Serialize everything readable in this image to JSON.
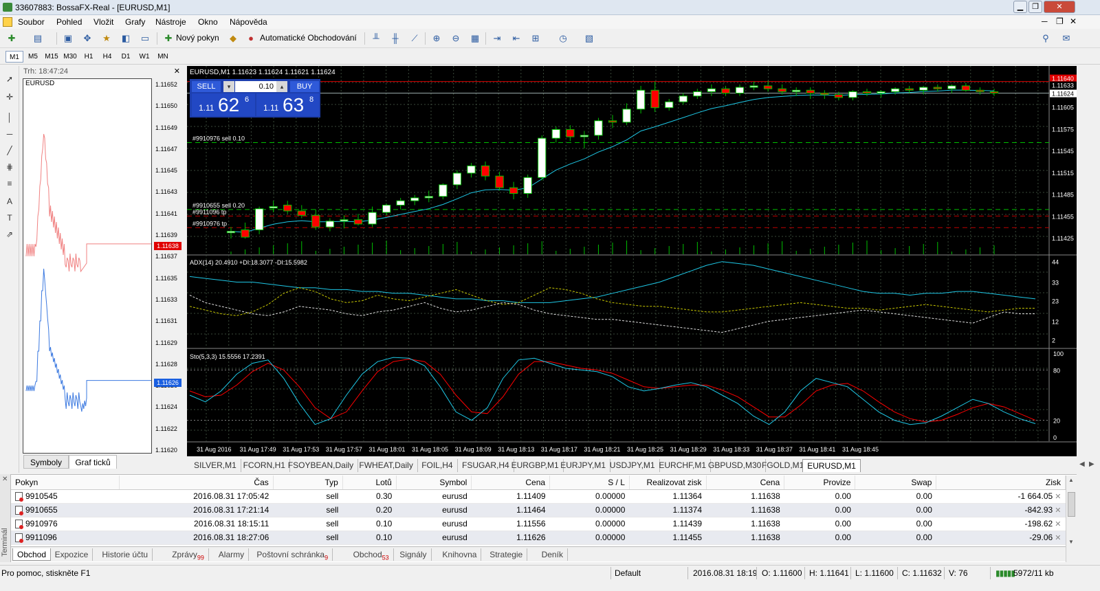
{
  "window": {
    "title": "33607883: BossaFX-Real - [EURUSD,M1]"
  },
  "menu": [
    "Soubor",
    "Pohled",
    "Vložit",
    "Grafy",
    "Nástroje",
    "Okno",
    "Nápověda"
  ],
  "toolbar": {
    "new_order": "Nový pokyn",
    "auto_trading": "Automatické Obchodování"
  },
  "timeframes": [
    "M1",
    "M5",
    "M15",
    "M30",
    "H1",
    "H4",
    "D1",
    "W1",
    "MN"
  ],
  "active_timeframe": "M1",
  "tick_panel": {
    "header": "Trh: 18:47:24",
    "symbol": "EURUSD",
    "scale": [
      "1.11652",
      "1.11650",
      "1.11649",
      "1.11647",
      "1.11645",
      "1.11643",
      "1.11641",
      "1.11639",
      "1.11637",
      "1.11635",
      "1.11633",
      "1.11631",
      "1.11629",
      "1.11628",
      "1.11626",
      "1.11624",
      "1.11622",
      "1.11620"
    ],
    "ask_tag": "1.11638",
    "bid_tag": "1.11626",
    "tabs": [
      "Symboly",
      "Graf ticků"
    ],
    "active_tab": "Graf ticků"
  },
  "chart": {
    "header": "EURUSD,M1  1.11623 1.11624 1.11621 1.11624",
    "sell_label": "SELL",
    "buy_label": "BUY",
    "lot": "0.10",
    "sell_price_small": "1.11",
    "sell_price_big": "62",
    "sell_price_sup": "6",
    "buy_price_small": "1.11",
    "buy_price_big": "63",
    "buy_price_sup": "8",
    "order_lines": [
      {
        "label": "#9910976 sell 0.10",
        "price": 1.11556,
        "color": "#00c000"
      },
      {
        "label": "#9910655 sell 0.20",
        "price": 1.11464,
        "color": "#00c000"
      },
      {
        "label": "#9911096 tp",
        "price": 1.11455,
        "color": "#c00000"
      },
      {
        "label": "#9910976 tp",
        "price": 1.11439,
        "color": "#c00000"
      }
    ],
    "price_scale": [
      "1.11640",
      "1.11633",
      "1.11624",
      "1.11605",
      "1.11575",
      "1.11545",
      "1.11515",
      "1.11485",
      "1.11455",
      "1.11425"
    ],
    "adx_header": "ADX(14) 20.4910 +DI:18.3077 -DI:15.5982",
    "adx_scale": [
      "44",
      "33",
      "23",
      "12",
      "2"
    ],
    "sto_header": "Sto(5,3,3) 15.5556 17.2391",
    "sto_scale": [
      "100",
      "80",
      "20",
      "0"
    ],
    "time_labels": [
      "31 Aug 2016",
      "31 Aug 17:49",
      "31 Aug 17:53",
      "31 Aug 17:57",
      "31 Aug 18:01",
      "31 Aug 18:05",
      "31 Aug 18:09",
      "31 Aug 18:13",
      "31 Aug 18:17",
      "31 Aug 18:21",
      "31 Aug 18:25",
      "31 Aug 18:29",
      "31 Aug 18:33",
      "31 Aug 18:37",
      "31 Aug 18:41",
      "31 Aug 18:45"
    ]
  },
  "chart_tabs": [
    "SILVER,M1",
    "FCORN,H1",
    "FSOYBEAN,Daily",
    "FWHEAT,Daily",
    "FOIL,H4",
    "FSUGAR,H4",
    "EURGBP,M1",
    "EURJPY,M1",
    "USDJPY,M1",
    "EURCHF,M1",
    "GBPUSD,M30",
    "FGOLD,M1",
    "EURUSD,M1"
  ],
  "active_chart_tab": "EURUSD,M1",
  "terminal": {
    "side_label": "Terminál",
    "columns": [
      "Pokyn",
      "Čas",
      "Typ",
      "Lotů",
      "Symbol",
      "Cena",
      "S / L",
      "Realizovat zisk",
      "Cena",
      "Provize",
      "Swap",
      "Zisk"
    ],
    "rows": [
      [
        "9910545",
        "2016.08.31 17:05:42",
        "sell",
        "0.30",
        "eurusd",
        "1.11409",
        "0.00000",
        "1.11364",
        "1.11638",
        "0.00",
        "0.00",
        "-1 664.05"
      ],
      [
        "9910655",
        "2016.08.31 17:21:14",
        "sell",
        "0.20",
        "eurusd",
        "1.11464",
        "0.00000",
        "1.11374",
        "1.11638",
        "0.00",
        "0.00",
        "-842.93"
      ],
      [
        "9910976",
        "2016.08.31 18:15:11",
        "sell",
        "0.10",
        "eurusd",
        "1.11556",
        "0.00000",
        "1.11439",
        "1.11638",
        "0.00",
        "0.00",
        "-198.62"
      ],
      [
        "9911096",
        "2016.08.31 18:27:06",
        "sell",
        "0.10",
        "eurusd",
        "1.11626",
        "0.00000",
        "1.11455",
        "1.11638",
        "0.00",
        "0.00",
        "-29.06"
      ]
    ],
    "tabs": [
      {
        "label": "Obchod",
        "badge": ""
      },
      {
        "label": "Expozice",
        "badge": ""
      },
      {
        "label": "Historie účtu",
        "badge": ""
      },
      {
        "label": "Zprávy",
        "badge": "99"
      },
      {
        "label": "Alarmy",
        "badge": ""
      },
      {
        "label": "Poštovní schránka",
        "badge": "9"
      },
      {
        "label": "Obchod",
        "badge": "53"
      },
      {
        "label": "Signály",
        "badge": ""
      },
      {
        "label": "Knihovna",
        "badge": ""
      },
      {
        "label": "Strategie",
        "badge": ""
      },
      {
        "label": "Deník",
        "badge": ""
      }
    ],
    "active_tab": "Obchod"
  },
  "status": {
    "help": "Pro pomoc, stiskněte F1",
    "profile": "Default",
    "datetime": "2016.08.31 18:19",
    "open": "O: 1.11600",
    "high": "H: 1.11641",
    "low": "L: 1.11600",
    "close": "C: 1.11632",
    "volume": "V: 76",
    "traffic": "5972/11 kb"
  },
  "colors": {
    "bull": "#ffffff",
    "bear": "#ff0000",
    "ma": "#1ec8e6",
    "sto_signal": "#ff0000",
    "sto_main": "#1ec8e6",
    "grid": "#3a4a3a",
    "ask_line": "#e00000",
    "bid_line": "#1a5fe0",
    "trade_panel": "#1d3fae"
  },
  "chart_data": {
    "type": "candlestick",
    "symbol": "EURUSD",
    "timeframe": "M1",
    "ohlc": [
      [
        1.11432,
        1.1144,
        1.11424,
        1.11434
      ],
      [
        1.11436,
        1.11446,
        1.11424,
        1.11426
      ],
      [
        1.11436,
        1.11468,
        1.1143,
        1.11465
      ],
      [
        1.11466,
        1.11476,
        1.1146,
        1.11468
      ],
      [
        1.1147,
        1.11476,
        1.11458,
        1.11462
      ],
      [
        1.11462,
        1.1147,
        1.11452,
        1.11456
      ],
      [
        1.11456,
        1.11464,
        1.11436,
        1.1144
      ],
      [
        1.1144,
        1.11452,
        1.11434,
        1.11448
      ],
      [
        1.11448,
        1.11456,
        1.11438,
        1.1145
      ],
      [
        1.1145,
        1.11458,
        1.11442,
        1.11444
      ],
      [
        1.11444,
        1.11468,
        1.1144,
        1.1146
      ],
      [
        1.1146,
        1.11472,
        1.11456,
        1.1147
      ],
      [
        1.1147,
        1.1148,
        1.11464,
        1.11476
      ],
      [
        1.11476,
        1.11484,
        1.1147,
        1.1148
      ],
      [
        1.1148,
        1.1149,
        1.11474,
        1.11482
      ],
      [
        1.11482,
        1.115,
        1.11478,
        1.11498
      ],
      [
        1.11498,
        1.11518,
        1.11492,
        1.11514
      ],
      [
        1.11514,
        1.11528,
        1.11508,
        1.11524
      ],
      [
        1.11524,
        1.1153,
        1.11504,
        1.1151
      ],
      [
        1.1151,
        1.11516,
        1.1149,
        1.11494
      ],
      [
        1.11494,
        1.11502,
        1.11478,
        1.11486
      ],
      [
        1.11486,
        1.11512,
        1.1148,
        1.11508
      ],
      [
        1.11508,
        1.11566,
        1.11504,
        1.11562
      ],
      [
        1.11562,
        1.11578,
        1.11556,
        1.11574
      ],
      [
        1.11574,
        1.1158,
        1.11558,
        1.11564
      ],
      [
        1.11564,
        1.11572,
        1.11548,
        1.11566
      ],
      [
        1.11566,
        1.1159,
        1.1156,
        1.11586
      ],
      [
        1.11586,
        1.11594,
        1.11576,
        1.11584
      ],
      [
        1.11584,
        1.1161,
        1.1158,
        1.11602
      ],
      [
        1.11602,
        1.11634,
        1.11596,
        1.11628
      ],
      [
        1.11628,
        1.1164,
        1.11598,
        1.11604
      ],
      [
        1.11604,
        1.11616,
        1.116,
        1.11612
      ],
      [
        1.11612,
        1.11624,
        1.11608,
        1.1162
      ],
      [
        1.1162,
        1.1163,
        1.11616,
        1.11626
      ],
      [
        1.11626,
        1.11636,
        1.1162,
        1.1163
      ],
      [
        1.1163,
        1.11634,
        1.1162,
        1.11624
      ],
      [
        1.11624,
        1.11636,
        1.1162,
        1.11632
      ],
      [
        1.11632,
        1.1164,
        1.11628,
        1.11634
      ],
      [
        1.11634,
        1.11641,
        1.11626,
        1.1163
      ],
      [
        1.1163,
        1.11636,
        1.11622,
        1.11626
      ],
      [
        1.11626,
        1.11632,
        1.1162,
        1.11628
      ],
      [
        1.11628,
        1.11632,
        1.11616,
        1.11624
      ],
      [
        1.11624,
        1.11628,
        1.11616,
        1.11622
      ],
      [
        1.11622,
        1.11626,
        1.11614,
        1.11618
      ],
      [
        1.11618,
        1.11628,
        1.11614,
        1.11626
      ],
      [
        1.11626,
        1.1163,
        1.1162,
        1.11624
      ],
      [
        1.11624,
        1.11628,
        1.11618,
        1.11626
      ],
      [
        1.11626,
        1.11632,
        1.11622,
        1.1163
      ],
      [
        1.1163,
        1.11634,
        1.11624,
        1.11628
      ],
      [
        1.11628,
        1.11634,
        1.11622,
        1.11632
      ],
      [
        1.11632,
        1.11636,
        1.11626,
        1.1163
      ],
      [
        1.1163,
        1.11636,
        1.11624,
        1.11634
      ],
      [
        1.11634,
        1.11638,
        1.11626,
        1.11628
      ],
      [
        1.11628,
        1.11632,
        1.11622,
        1.11626
      ],
      [
        1.11626,
        1.1163,
        1.1162,
        1.11624
      ]
    ],
    "ylim": [
      1.1141,
      1.1165
    ],
    "adx": {
      "ylim": [
        0,
        45
      ],
      "adx": [
        36,
        35,
        34,
        33,
        33,
        32,
        31,
        30,
        30,
        29,
        29,
        28,
        28,
        27,
        27,
        26,
        25,
        24,
        24,
        23,
        23,
        22,
        22,
        22,
        23,
        24,
        25,
        27,
        29,
        31,
        33,
        36,
        39,
        42,
        44,
        43,
        42,
        40,
        38,
        36,
        34,
        32,
        30,
        28,
        27,
        27,
        26,
        27,
        27,
        28,
        28,
        27,
        26,
        25,
        24
      ],
      "plus_di": [
        20,
        18,
        16,
        15,
        17,
        21,
        27,
        30,
        28,
        24,
        22,
        23,
        26,
        24,
        23,
        25,
        27,
        29,
        26,
        23,
        21,
        22,
        26,
        30,
        29,
        27,
        24,
        22,
        21,
        20,
        20,
        19,
        18,
        17,
        17,
        18,
        19,
        20,
        21,
        22,
        21,
        20,
        19,
        19,
        18,
        19,
        20,
        21,
        20,
        19,
        18,
        17,
        18,
        19,
        19
      ],
      "minus_di": [
        26,
        22,
        20,
        18,
        16,
        15,
        17,
        20,
        19,
        18,
        16,
        15,
        17,
        18,
        20,
        22,
        19,
        17,
        18,
        20,
        22,
        21,
        18,
        16,
        15,
        14,
        13,
        13,
        12,
        11,
        10,
        9,
        8,
        7,
        6,
        8,
        10,
        12,
        13,
        14,
        15,
        16,
        17,
        18,
        17,
        16,
        15,
        14,
        13,
        12,
        11,
        14,
        17,
        16,
        16
      ]
    },
    "stochastic": {
      "ylim": [
        0,
        100
      ],
      "main": [
        50,
        42,
        55,
        75,
        88,
        92,
        70,
        40,
        15,
        22,
        50,
        75,
        90,
        95,
        94,
        85,
        60,
        30,
        20,
        35,
        70,
        92,
        94,
        88,
        82,
        80,
        78,
        72,
        60,
        55,
        58,
        62,
        65,
        60,
        50,
        40,
        25,
        15,
        30,
        55,
        70,
        65,
        60,
        45,
        30,
        20,
        15,
        17,
        25,
        35,
        45,
        40,
        30,
        22,
        16
      ],
      "signal": [
        55,
        48,
        50,
        62,
        78,
        88,
        80,
        60,
        35,
        22,
        30,
        55,
        78,
        90,
        93,
        90,
        75,
        50,
        30,
        28,
        48,
        75,
        90,
        90,
        86,
        82,
        80,
        76,
        68,
        60,
        58,
        60,
        62,
        62,
        56,
        48,
        36,
        24,
        24,
        38,
        55,
        62,
        64,
        55,
        42,
        30,
        22,
        18,
        20,
        27,
        35,
        40,
        36,
        28,
        20
      ]
    }
  }
}
